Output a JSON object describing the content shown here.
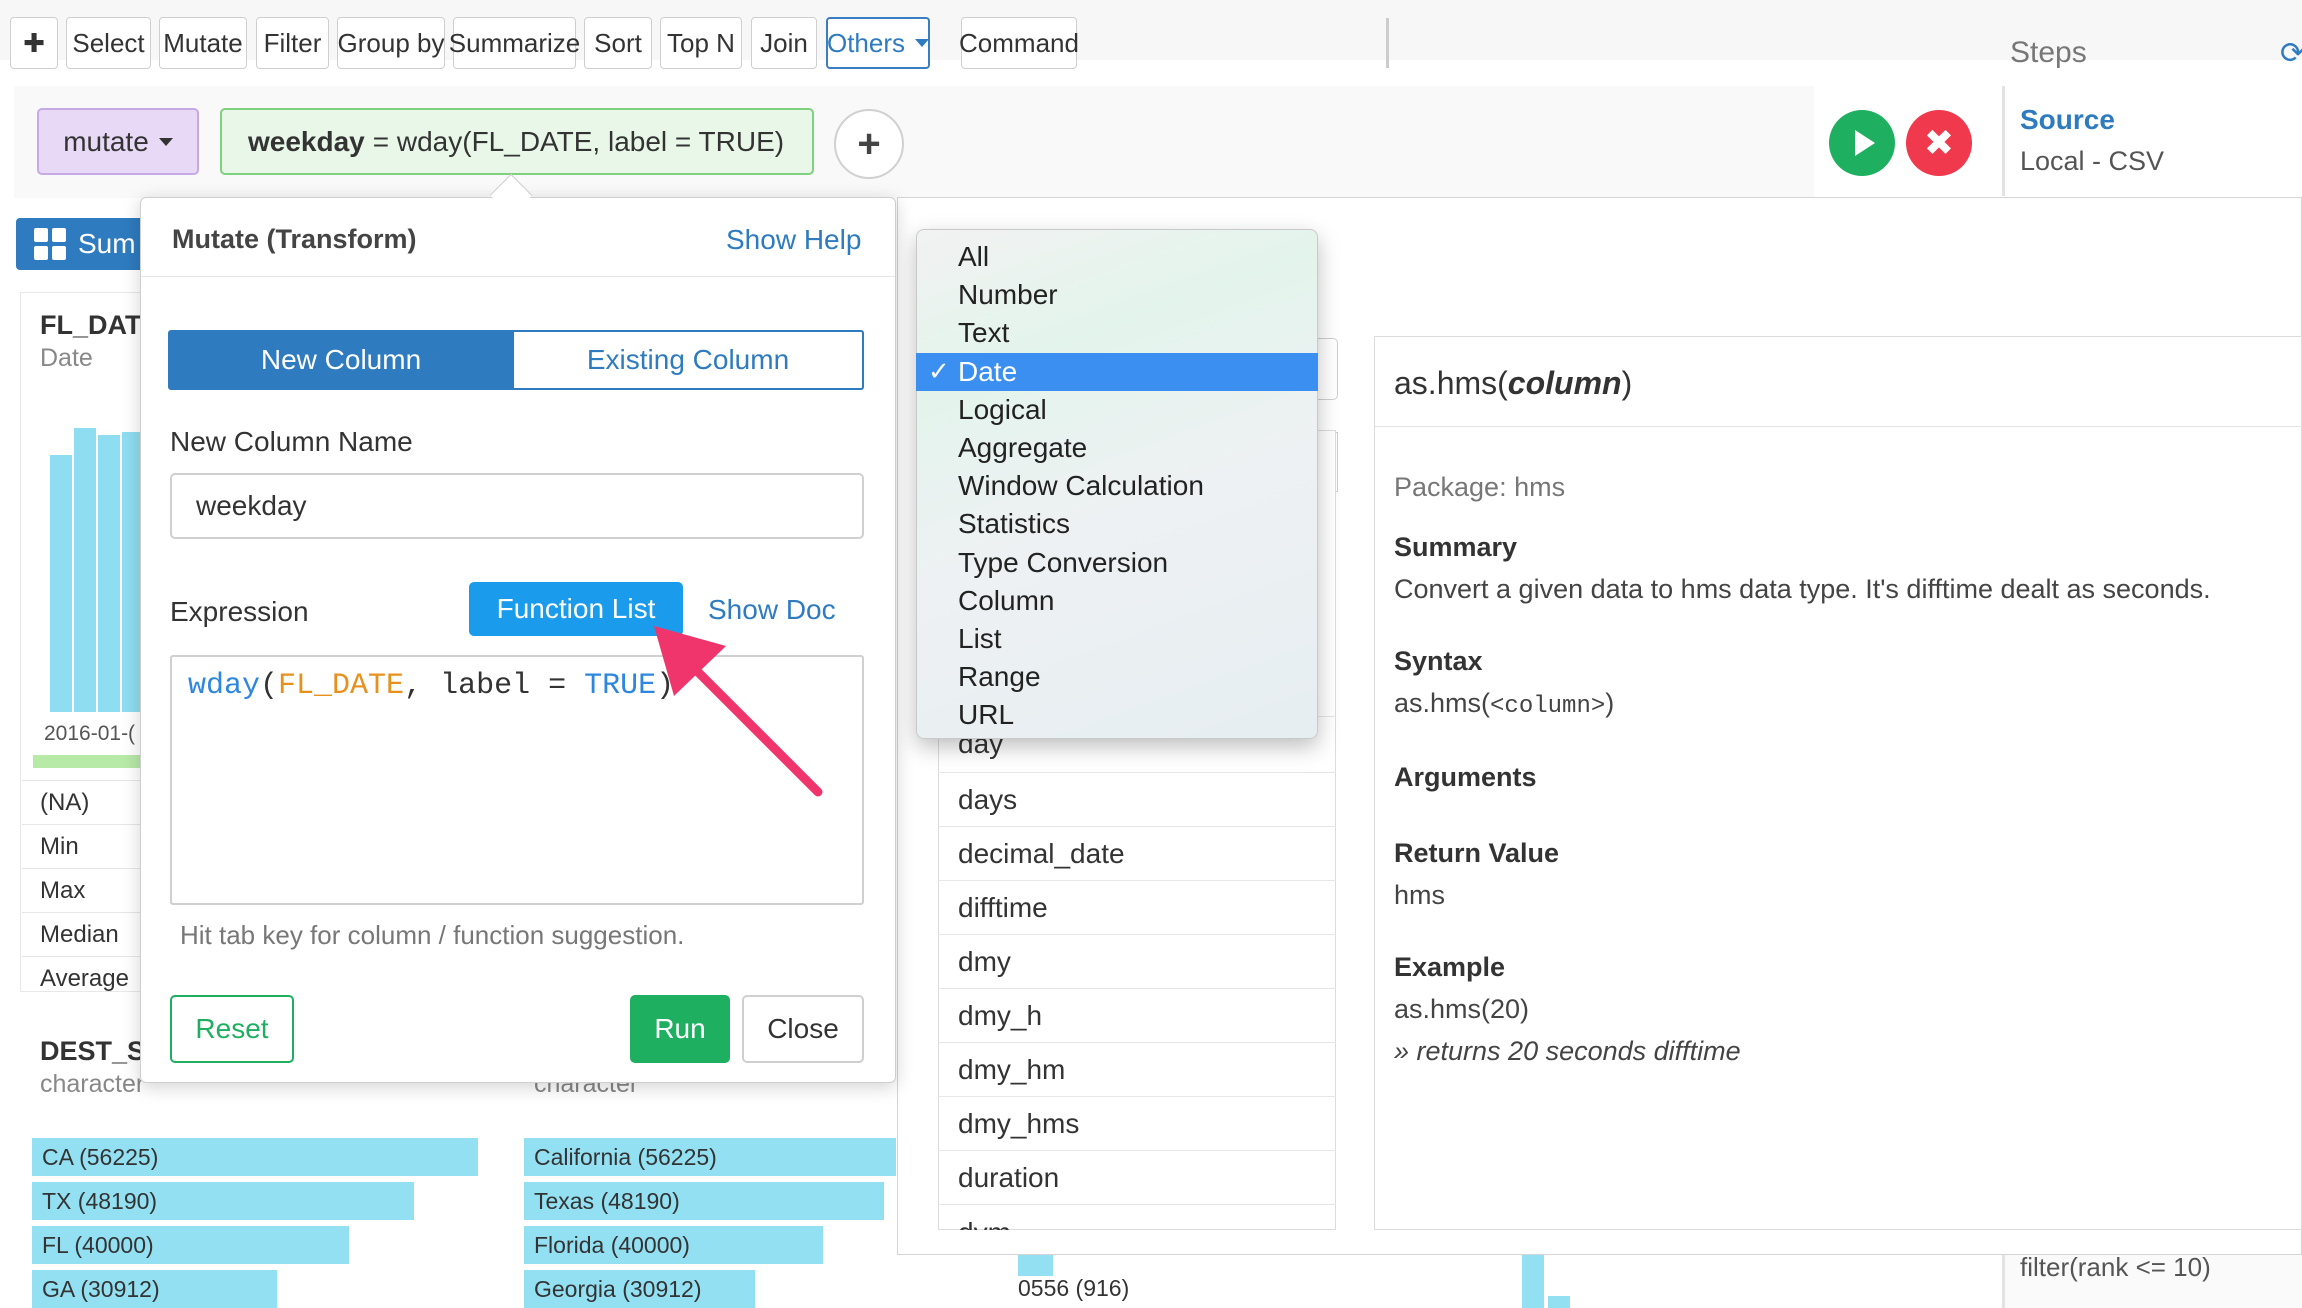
{
  "toolbar": {
    "plus": "✚",
    "buttons": [
      "Select",
      "Mutate",
      "Filter",
      "Group by",
      "Summarize",
      "Sort",
      "Top N",
      "Join"
    ],
    "others": "Others",
    "command": "Command"
  },
  "steps": {
    "title": "Steps",
    "refresh_icon": "⟳",
    "source_title": "Source",
    "source_sub": "Local - CSV",
    "filter_step": "filter(rank <= 10)"
  },
  "mutate_bar": {
    "verb": "mutate",
    "chip_name": "weekday",
    "chip_expr": "= wday(FL_DATE, label = TRUE)",
    "add": "+",
    "cancel": "✖"
  },
  "background": {
    "summary_tab": "Sum",
    "fl_title": "FL_DAT",
    "fl_type": "Date",
    "hist_axis": "2016-01-(",
    "hist_values": [
      0.78,
      0.86,
      0.84,
      0.85,
      0.81
    ],
    "stats": [
      "(NA)",
      "Min",
      "Max",
      "Median",
      "Average"
    ],
    "dest_title": "DEST_S",
    "dest_type": "character",
    "char2": "character",
    "states_short": [
      "CA (56225)",
      "TX (48190)",
      "FL (40000)",
      "GA (30912)"
    ],
    "states_long": [
      "California (56225)",
      "Texas (48190)",
      "Florida (40000)",
      "Georgia (30912)"
    ],
    "state_counts": [
      56225,
      48190,
      40000,
      30912
    ],
    "cat_0556": "0556 (916)"
  },
  "dialog": {
    "title": "Mutate (Transform)",
    "show_help": "Show Help",
    "new_column": "New Column",
    "existing_column": "Existing Column",
    "new_column_name_label": "New Column Name",
    "new_column_name_value": "weekday",
    "expression_label": "Expression",
    "function_list": "Function List",
    "show_doc": "Show Doc",
    "code": {
      "fn": "wday",
      "paren_open": "(",
      "col": "FL_DATE",
      "comma": ", ",
      "arg": "label",
      "eq": " = ",
      "val": "TRUE",
      "paren_close": ")"
    },
    "hint": "Hit tab key for column / function suggestion.",
    "reset": "Reset",
    "run": "Run",
    "close": "Close"
  },
  "category_menu": {
    "items": [
      "All",
      "Number",
      "Text",
      "Date",
      "Logical",
      "Aggregate",
      "Window Calculation",
      "Statistics",
      "Type Conversion",
      "Column",
      "List",
      "Range",
      "URL"
    ],
    "selected": "Date",
    "check": "✓"
  },
  "function_list": {
    "items": [
      "day",
      "days",
      "decimal_date",
      "difftime",
      "dmy",
      "dmy_h",
      "dmy_hm",
      "dmy_hms",
      "duration",
      "dym"
    ]
  },
  "doc": {
    "title_fn": "as.hms(",
    "title_arg": "column",
    "title_end": ")",
    "package": "Package: hms",
    "summary_h": "Summary",
    "summary": "Convert a given data to hms data type. It's difftime dealt as seconds.",
    "syntax_h": "Syntax",
    "syntax_fn": "as.hms(",
    "syntax_arg": "<column>",
    "syntax_end": ")",
    "arguments_h": "Arguments",
    "return_h": "Return Value",
    "return_val": "hms",
    "example_h": "Example",
    "example_code": "as.hms(20)",
    "example_note": "»  returns 20 seconds difftime"
  },
  "colors": {
    "accent": "#2e7bbf",
    "run_green": "#1eb060",
    "cancel_red": "#f0394c",
    "function_list_blue": "#1a9bec",
    "menu_selected": "#3a8ff0",
    "arrow_pink": "#f0356c"
  }
}
